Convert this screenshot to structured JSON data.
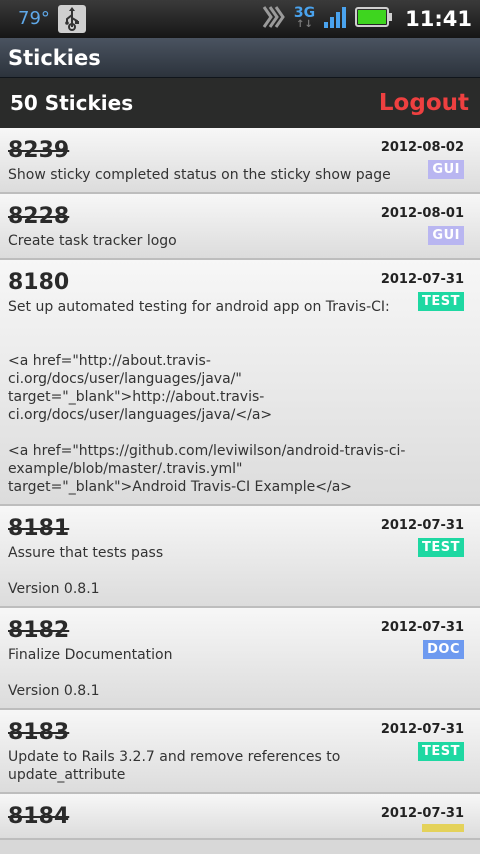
{
  "status_bar": {
    "temperature": "79°",
    "network": "3G",
    "time": "11:41"
  },
  "app": {
    "title": "Stickies"
  },
  "header": {
    "count_label": "50 Stickies",
    "logout_label": "Logout"
  },
  "stickies": [
    {
      "number": "8239",
      "completed": true,
      "date": "2012-08-02",
      "tag": "GUI",
      "text": "Show sticky completed status on the sticky show page"
    },
    {
      "number": "8228",
      "completed": true,
      "date": "2012-08-01",
      "tag": "GUI",
      "text": "Create task tracker logo"
    },
    {
      "number": "8180",
      "completed": false,
      "date": "2012-07-31",
      "tag": "TEST",
      "text": "Set up automated testing for android app on Travis-CI:\n\n\n<a href=\"http://about.travis-ci.org/docs/user/languages/java/\" target=\"_blank\">http://about.travis-ci.org/docs/user/languages/java/</a>\n\n<a href=\"https://github.com/leviwilson/android-travis-ci-example/blob/master/.travis.yml\" target=\"_blank\">Android Travis-CI Example</a>"
    },
    {
      "number": "8181",
      "completed": true,
      "date": "2012-07-31",
      "tag": "TEST",
      "text": "Assure that tests pass\n\nVersion 0.8.1"
    },
    {
      "number": "8182",
      "completed": true,
      "date": "2012-07-31",
      "tag": "DOC",
      "text": "Finalize Documentation\n\nVersion 0.8.1"
    },
    {
      "number": "8183",
      "completed": true,
      "date": "2012-07-31",
      "tag": "TEST",
      "text": "Update to Rails 3.2.7 and remove references to update_attribute"
    },
    {
      "number": "8184",
      "completed": true,
      "date": "2012-07-31",
      "tag": "",
      "text": ""
    }
  ]
}
